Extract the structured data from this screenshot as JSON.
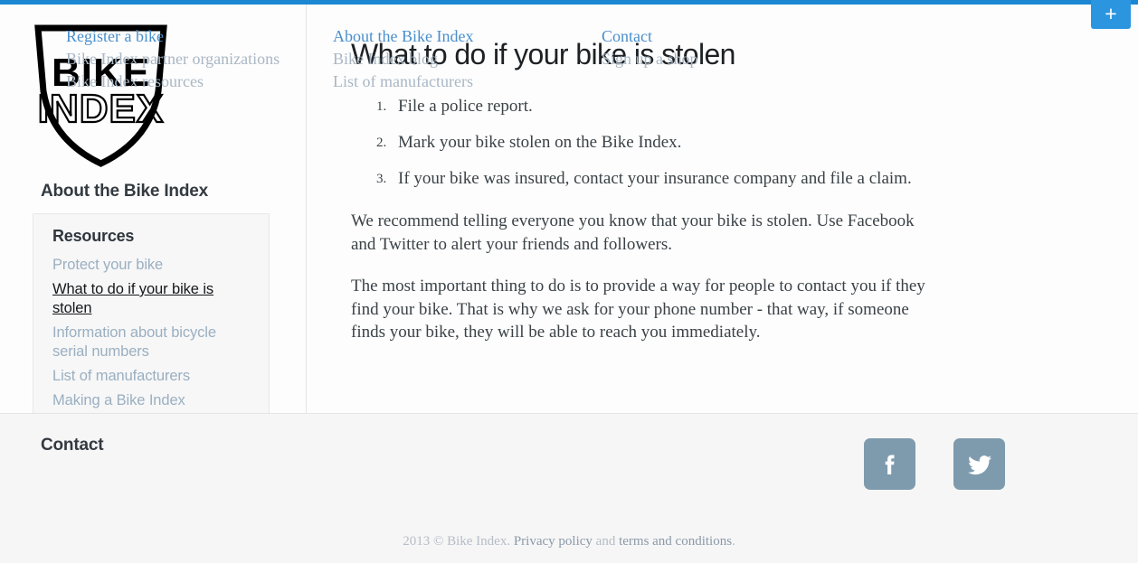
{
  "topbar": {
    "accent_color": "#1b87d2",
    "add_button_label": "+",
    "add_button_icon": "plus-icon"
  },
  "sidebar": {
    "logo_text_top": "BIKE",
    "logo_text_bottom": "INDEX",
    "about_heading": "About the Bike Index",
    "contact_heading": "Contact",
    "resources": {
      "title": "Resources",
      "items": [
        {
          "label": "Protect your bike",
          "active": false
        },
        {
          "label": "What to do if your bike is stolen",
          "active": true
        },
        {
          "label": "Information about bicycle serial numbers",
          "active": false
        },
        {
          "label": "List of manufacturers",
          "active": false
        },
        {
          "label": "Making a Bike Index spokecard",
          "active": false
        }
      ]
    }
  },
  "main": {
    "title": "What to do if your bike is stolen",
    "steps": [
      "File a police report.",
      "Mark your bike stolen on the Bike Index.",
      "If your bike was insured, contact your insurance company and file a claim."
    ],
    "paragraphs": [
      "We recommend telling everyone you know that your bike is stolen. Use Facebook and Twitter to alert your friends and followers.",
      "The most important thing to do is to provide a way for people to contact you if they find your bike. That is why we ask for your phone number - that way, if someone finds your bike, they will be able to reach you immediately."
    ]
  },
  "footer": {
    "columns": [
      {
        "links": [
          {
            "label": "Register a bike",
            "primary": true
          },
          {
            "label": "Bike Index partner organizations",
            "primary": false
          },
          {
            "label": "Bike Index resources",
            "primary": false
          }
        ]
      },
      {
        "links": [
          {
            "label": "About the Bike Index",
            "primary": true
          },
          {
            "label": "Bike Index blog",
            "primary": false
          },
          {
            "label": "List of manufacturers",
            "primary": false
          }
        ]
      },
      {
        "links": [
          {
            "label": "Contact",
            "primary": true
          },
          {
            "label": "Sign up a shop",
            "primary": false
          }
        ]
      }
    ],
    "social": [
      {
        "name": "facebook-icon",
        "label": "Facebook"
      },
      {
        "name": "twitter-icon",
        "label": "Twitter"
      }
    ],
    "copyright": {
      "prefix": "2013 © Bike Index.",
      "privacy_link": "Privacy policy",
      "conjunction": "and",
      "terms_link": "terms and conditions",
      "suffix": "."
    }
  }
}
